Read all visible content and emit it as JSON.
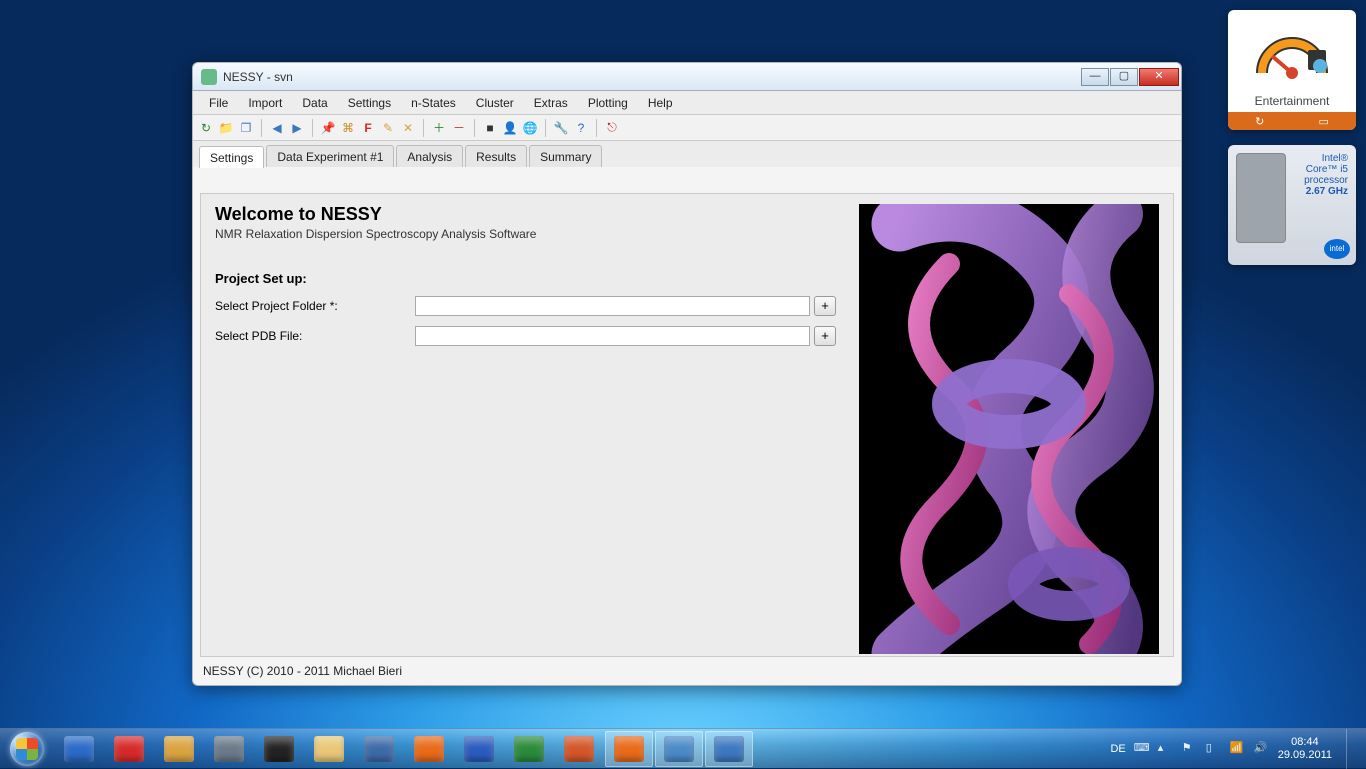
{
  "window": {
    "title": "NESSY - svn"
  },
  "menubar": [
    "File",
    "Import",
    "Data",
    "Settings",
    "n-States",
    "Cluster",
    "Extras",
    "Plotting",
    "Help"
  ],
  "toolbar_icons": [
    "refresh",
    "folder",
    "copy",
    "back",
    "forward",
    "pin",
    "cmd",
    "F",
    "edit",
    "delete",
    "add",
    "remove",
    "rec",
    "user",
    "globe",
    "wrench",
    "help",
    "exit"
  ],
  "tabs": [
    "Settings",
    "Data Experiment #1",
    "Analysis",
    "Results",
    "Summary"
  ],
  "active_tab": 0,
  "settings": {
    "heading": "Welcome to NESSY",
    "subtitle": "NMR Relaxation Dispersion Spectroscopy Analysis Software",
    "section": "Project Set up:",
    "rows": [
      {
        "label": "Select Project Folder *:",
        "value": "",
        "button": "+"
      },
      {
        "label": "Select PDB File:",
        "value": "",
        "button": "+"
      }
    ]
  },
  "statusbar": "NESSY (C) 2010 - 2011 Michael Bieri",
  "gadgets": {
    "she_label": "Entertainment",
    "cpu": {
      "l1": "Intel®",
      "l2": "Core™ i5",
      "l3": "processor",
      "l4": "2.67 GHz",
      "badge": "intel"
    }
  },
  "taskbar": {
    "apps": [
      "itunes",
      "ifolor",
      "lamp",
      "virtualbox",
      "terminal",
      "explorer",
      "thunderbird",
      "firefox",
      "word",
      "excel",
      "powerpoint",
      "orange",
      "controlpanel",
      "python"
    ],
    "active_indices": [
      11,
      12,
      13
    ],
    "lang": "DE",
    "time": "08:44",
    "date": "29.09.2011"
  }
}
